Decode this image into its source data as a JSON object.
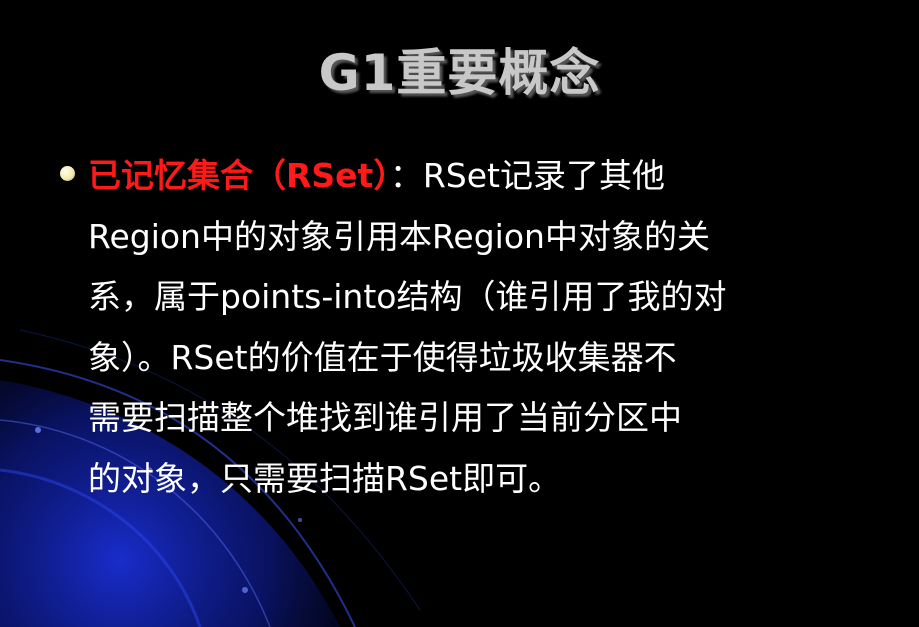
{
  "slide": {
    "title": "G1重要概念",
    "bullet": {
      "term": "已记忆集合（RSet）",
      "separator": "：",
      "lines": [
        "RSet记录了其他",
        "Region中的对象引用本Region中对象的关",
        "系，属于points-into结构（谁引用了我的对",
        "象）。RSet的价值在于使得垃圾收集器不",
        "需要扫描整个堆找到谁引用了当前分区中",
        "的对象，只需要扫描RSet即可。"
      ]
    }
  },
  "colors": {
    "background": "#000000",
    "title": "#c8c8c8",
    "term": "#ff1a1a",
    "text": "#ffffff",
    "bullet": "#f2ecb0",
    "swirl": "#1a2fd6"
  }
}
